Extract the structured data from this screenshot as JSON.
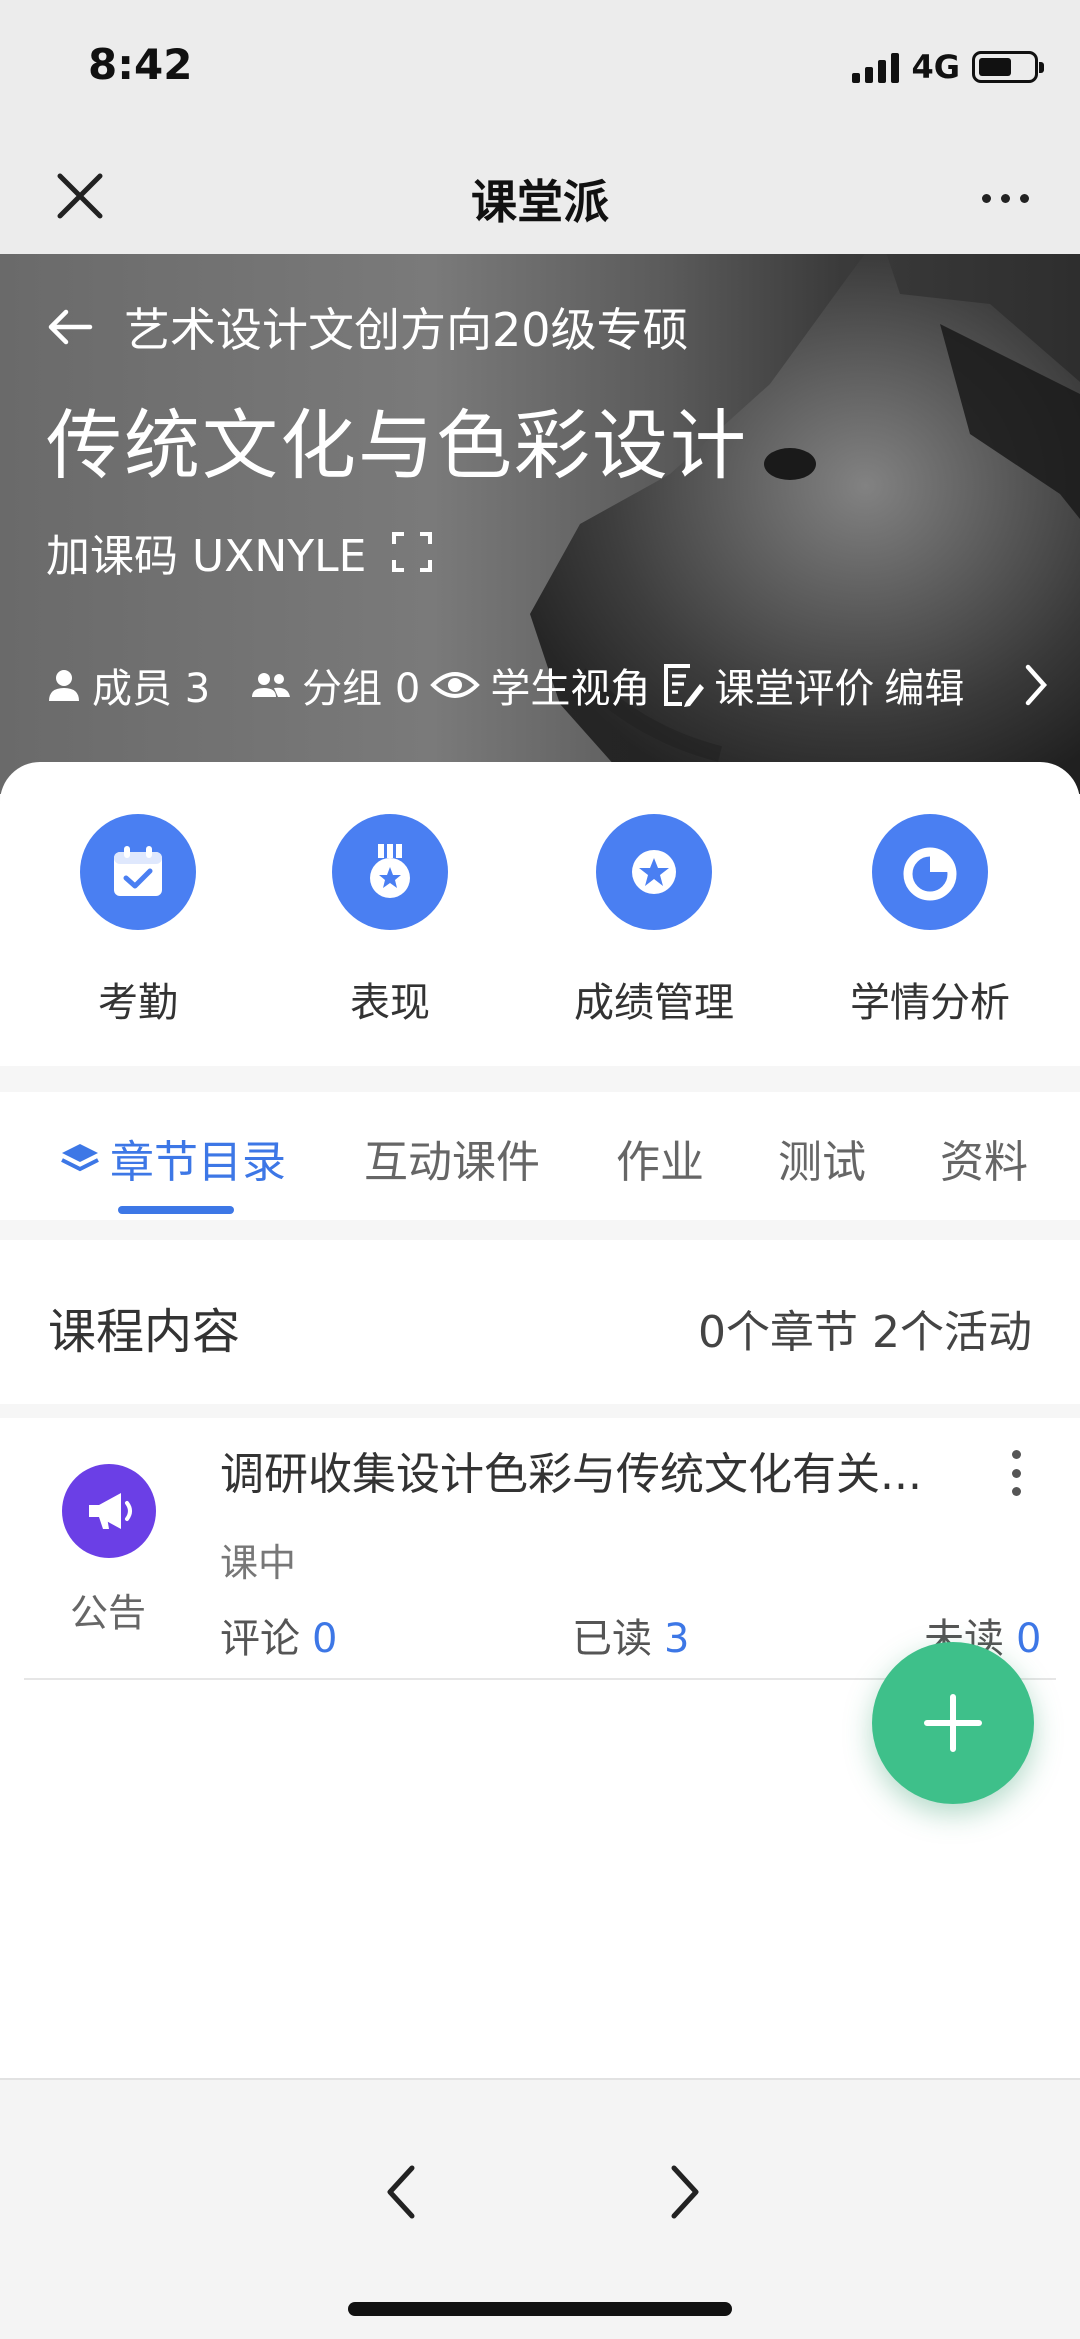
{
  "status_bar": {
    "time": "8:42",
    "network": "4G",
    "battery_level": 0.62
  },
  "nav": {
    "title": "课堂派"
  },
  "hero": {
    "class_name": "艺术设计文创方向20级专硕",
    "course_title": "传统文化与色彩设计",
    "join_code_label": "加课码 UXNYLE",
    "stats": {
      "members": "成员 3",
      "groups": "分组 0",
      "student_view": "学生视角",
      "evaluation": "课堂评价",
      "edit": "编辑"
    }
  },
  "actions": [
    {
      "label": "考勤",
      "icon": "calendar-check-icon"
    },
    {
      "label": "表现",
      "icon": "medal-icon"
    },
    {
      "label": "成绩管理",
      "icon": "star-badge-icon"
    },
    {
      "label": "学情分析",
      "icon": "pie-chart-icon"
    }
  ],
  "tabs": [
    {
      "label": "章节目录",
      "active": true
    },
    {
      "label": "互动课件"
    },
    {
      "label": "作业"
    },
    {
      "label": "测试"
    },
    {
      "label": "资料"
    }
  ],
  "section": {
    "title": "课程内容",
    "counts": "0个章节 2个活动"
  },
  "items": [
    {
      "type_label": "公告",
      "title": "调研收集设计色彩与传统文化有关...",
      "status": "课中",
      "comments_label": "评论",
      "comments": "0",
      "read_label": "已读",
      "read": "3",
      "unread_label": "未读",
      "unread": "0"
    }
  ],
  "colors": {
    "accent": "#3d77e6",
    "action_blue": "#4a7ff2",
    "fab_green": "#3ec08a",
    "announce_purple": "#6b3fe6"
  }
}
